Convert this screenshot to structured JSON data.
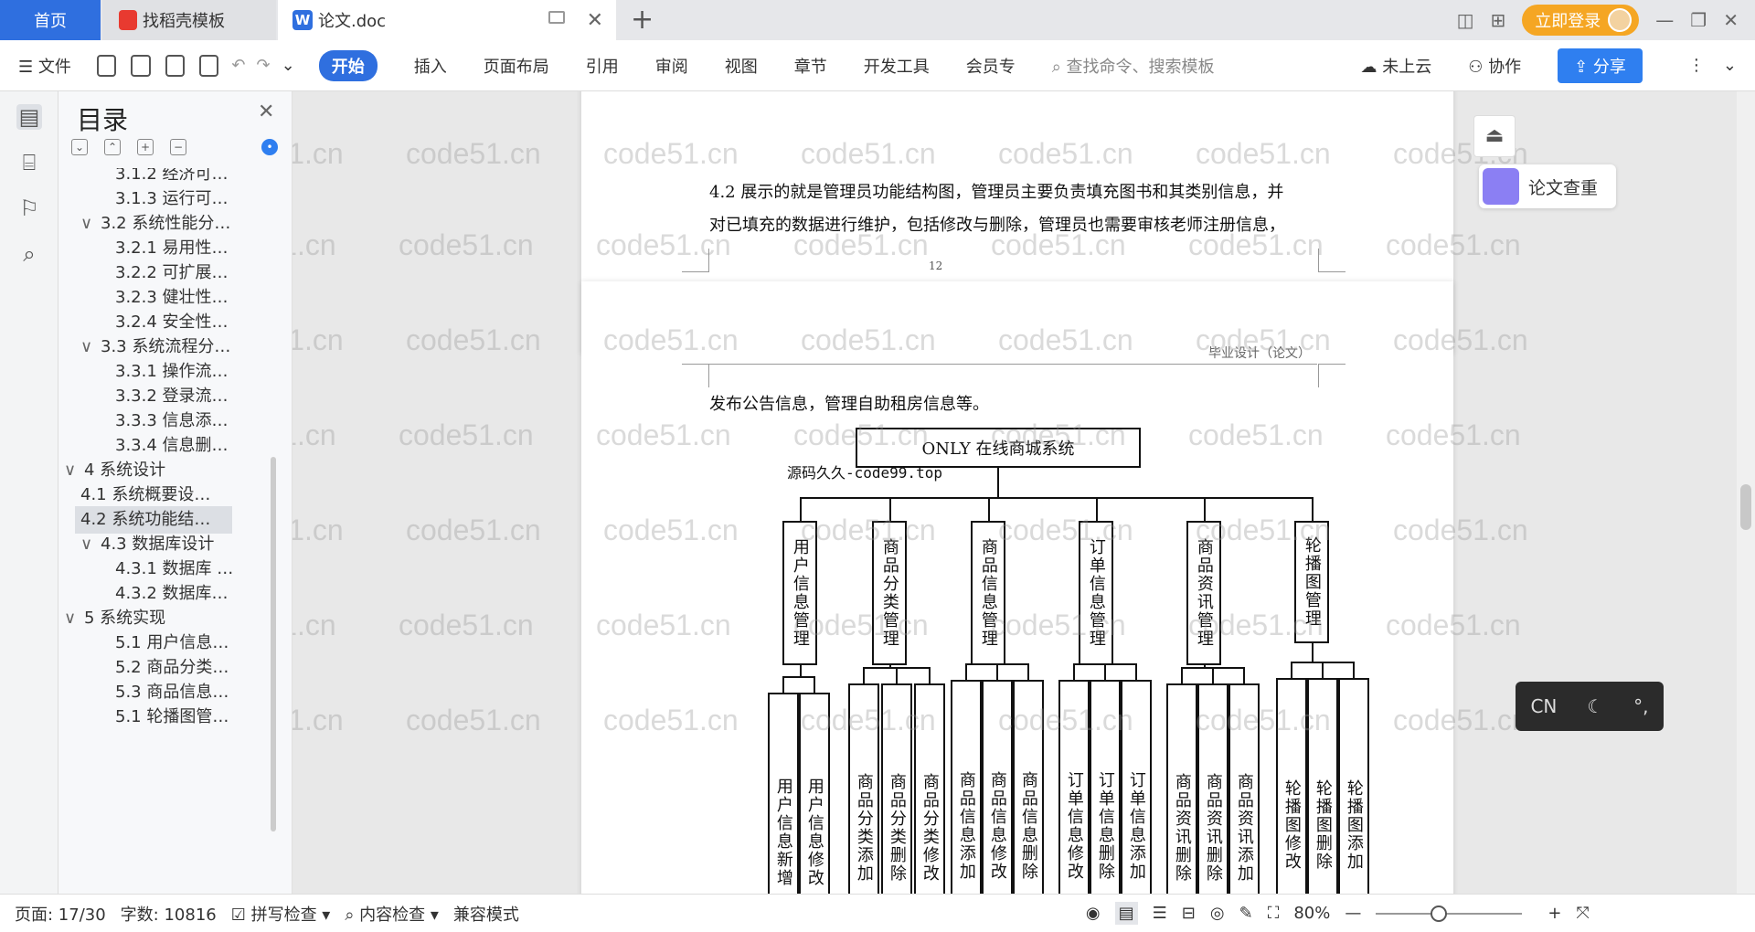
{
  "tabs": {
    "home": "首页",
    "docer": "找稻壳模板",
    "doc": "论文.doc",
    "add": "+"
  },
  "header": {
    "login": "立即登录"
  },
  "toolbar": {
    "file": "文件",
    "start": "开始",
    "insert": "插入",
    "layout": "页面布局",
    "reference": "引用",
    "review": "审阅",
    "view": "视图",
    "chapter": "章节",
    "dev": "开发工具",
    "member": "会员专",
    "search": "查找命令、搜索模板",
    "cloud": "未上云",
    "collab": "协作",
    "share": "分享"
  },
  "toc": {
    "title": "目录",
    "items": [
      {
        "label": "3.1.2  经济可…",
        "level": 3
      },
      {
        "label": "3.1.3  运行可…",
        "level": 3
      },
      {
        "label": "3.2  系统性能分…",
        "level": 2,
        "chevron": "∨"
      },
      {
        "label": "3.2.1  易用性…",
        "level": 3
      },
      {
        "label": "3.2.2  可扩展…",
        "level": 3
      },
      {
        "label": "3.2.3  健壮性…",
        "level": 3
      },
      {
        "label": "3.2.4  安全性…",
        "level": 3
      },
      {
        "label": "3.3  系统流程分…",
        "level": 2,
        "chevron": "∨"
      },
      {
        "label": "3.3.1  操作流…",
        "level": 3
      },
      {
        "label": "3.3.2  登录流…",
        "level": 3
      },
      {
        "label": "3.3.3  信息添…",
        "level": 3
      },
      {
        "label": "3.3.4  信息删…",
        "level": 3
      },
      {
        "label": "4  系统设计",
        "level": 1,
        "chevron": "∨"
      },
      {
        "label": "4.1  系统概要设…",
        "level": 2
      },
      {
        "label": "4.2  系统功能结…",
        "level": 2,
        "active": true
      },
      {
        "label": "4.3  数据库设计",
        "level": 2,
        "chevron": "∨"
      },
      {
        "label": "4.3.1  数据库 …",
        "level": 3
      },
      {
        "label": "4.3.2  数据库…",
        "level": 3
      },
      {
        "label": "5  系统实现",
        "level": 1,
        "chevron": "∨"
      },
      {
        "label": "5.1 用户信息…",
        "level": 3
      },
      {
        "label": "5.2  商品分类…",
        "level": 3
      },
      {
        "label": "5.3 商品信息…",
        "level": 3
      },
      {
        "label": "5.1 轮播图管…",
        "level": 3
      }
    ]
  },
  "document": {
    "p1_line1": "4.2 展示的就是管理员功能结构图，管理员主要负责填充图书和其类别信息，并",
    "p1_line2": "对已填充的数据进行维护，包括修改与删除，管理员也需要审核老师注册信息，",
    "page_number": "12",
    "p2_header": "毕业设计（论文）",
    "p2_line1": "发布公告信息，管理自助租房信息等。",
    "source_label": "源码久久-code99.top"
  },
  "diagram": {
    "root": "ONLY 在线商城系统",
    "modules": [
      {
        "label": "用户信息管理",
        "children": [
          "用户信息新增",
          "用户信息修改"
        ]
      },
      {
        "label": "商品分类管理",
        "children": [
          "商品分类添加",
          "商品分类删除",
          "商品分类修改"
        ]
      },
      {
        "label": "商品信息管理",
        "children": [
          "商品信息添加",
          "商品信息修改",
          "商品信息删除"
        ]
      },
      {
        "label": "订单信息管理",
        "children": [
          "订单信息修改",
          "订单信息删除",
          "订单信息添加"
        ]
      },
      {
        "label": "商品资讯管理",
        "children": [
          "商品资讯删除",
          "商品资讯删除",
          "商品资讯添加"
        ]
      },
      {
        "label": "轮播图管理",
        "children": [
          "轮播图修改",
          "轮播图删除",
          "轮播图添加"
        ]
      }
    ]
  },
  "watermark": "code51.cn",
  "side": {
    "paper_check": "论文查重",
    "ime_lang": "CN"
  },
  "status": {
    "page": "页面: 17/30",
    "words": "字数: 10816",
    "spell": "拼写检查",
    "content_check": "内容检查",
    "compat": "兼容模式",
    "zoom": "80%"
  },
  "colors": {
    "accent": "#2f6fdf",
    "login": "#f5a623"
  }
}
